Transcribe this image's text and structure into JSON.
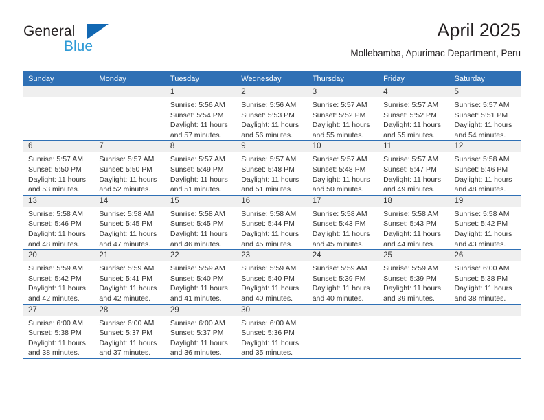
{
  "logo": {
    "primary_text": "General",
    "secondary_text": "Blue",
    "triangle_icon": "blue-triangle-icon",
    "primary_color": "#231f20",
    "secondary_color": "#2e9ad6",
    "triangle_color": "#1268b3"
  },
  "header": {
    "title": "April 2025",
    "subtitle": "Mollebamba, Apurimac Department, Peru"
  },
  "theme": {
    "header_blue": "#2f70b5",
    "daynum_band": "#efefef",
    "text": "#333333"
  },
  "calendar": {
    "weekday_headers": [
      "Sunday",
      "Monday",
      "Tuesday",
      "Wednesday",
      "Thursday",
      "Friday",
      "Saturday"
    ],
    "weeks": [
      [
        {
          "day": "",
          "sunrise": "",
          "sunset": "",
          "daylight": "",
          "empty": true
        },
        {
          "day": "",
          "sunrise": "",
          "sunset": "",
          "daylight": "",
          "empty": true
        },
        {
          "day": "1",
          "sunrise": "Sunrise: 5:56 AM",
          "sunset": "Sunset: 5:54 PM",
          "daylight": "Daylight: 11 hours and 57 minutes."
        },
        {
          "day": "2",
          "sunrise": "Sunrise: 5:56 AM",
          "sunset": "Sunset: 5:53 PM",
          "daylight": "Daylight: 11 hours and 56 minutes."
        },
        {
          "day": "3",
          "sunrise": "Sunrise: 5:57 AM",
          "sunset": "Sunset: 5:52 PM",
          "daylight": "Daylight: 11 hours and 55 minutes."
        },
        {
          "day": "4",
          "sunrise": "Sunrise: 5:57 AM",
          "sunset": "Sunset: 5:52 PM",
          "daylight": "Daylight: 11 hours and 55 minutes."
        },
        {
          "day": "5",
          "sunrise": "Sunrise: 5:57 AM",
          "sunset": "Sunset: 5:51 PM",
          "daylight": "Daylight: 11 hours and 54 minutes."
        }
      ],
      [
        {
          "day": "6",
          "sunrise": "Sunrise: 5:57 AM",
          "sunset": "Sunset: 5:50 PM",
          "daylight": "Daylight: 11 hours and 53 minutes."
        },
        {
          "day": "7",
          "sunrise": "Sunrise: 5:57 AM",
          "sunset": "Sunset: 5:50 PM",
          "daylight": "Daylight: 11 hours and 52 minutes."
        },
        {
          "day": "8",
          "sunrise": "Sunrise: 5:57 AM",
          "sunset": "Sunset: 5:49 PM",
          "daylight": "Daylight: 11 hours and 51 minutes."
        },
        {
          "day": "9",
          "sunrise": "Sunrise: 5:57 AM",
          "sunset": "Sunset: 5:48 PM",
          "daylight": "Daylight: 11 hours and 51 minutes."
        },
        {
          "day": "10",
          "sunrise": "Sunrise: 5:57 AM",
          "sunset": "Sunset: 5:48 PM",
          "daylight": "Daylight: 11 hours and 50 minutes."
        },
        {
          "day": "11",
          "sunrise": "Sunrise: 5:57 AM",
          "sunset": "Sunset: 5:47 PM",
          "daylight": "Daylight: 11 hours and 49 minutes."
        },
        {
          "day": "12",
          "sunrise": "Sunrise: 5:58 AM",
          "sunset": "Sunset: 5:46 PM",
          "daylight": "Daylight: 11 hours and 48 minutes."
        }
      ],
      [
        {
          "day": "13",
          "sunrise": "Sunrise: 5:58 AM",
          "sunset": "Sunset: 5:46 PM",
          "daylight": "Daylight: 11 hours and 48 minutes."
        },
        {
          "day": "14",
          "sunrise": "Sunrise: 5:58 AM",
          "sunset": "Sunset: 5:45 PM",
          "daylight": "Daylight: 11 hours and 47 minutes."
        },
        {
          "day": "15",
          "sunrise": "Sunrise: 5:58 AM",
          "sunset": "Sunset: 5:45 PM",
          "daylight": "Daylight: 11 hours and 46 minutes."
        },
        {
          "day": "16",
          "sunrise": "Sunrise: 5:58 AM",
          "sunset": "Sunset: 5:44 PM",
          "daylight": "Daylight: 11 hours and 45 minutes."
        },
        {
          "day": "17",
          "sunrise": "Sunrise: 5:58 AM",
          "sunset": "Sunset: 5:43 PM",
          "daylight": "Daylight: 11 hours and 45 minutes."
        },
        {
          "day": "18",
          "sunrise": "Sunrise: 5:58 AM",
          "sunset": "Sunset: 5:43 PM",
          "daylight": "Daylight: 11 hours and 44 minutes."
        },
        {
          "day": "19",
          "sunrise": "Sunrise: 5:58 AM",
          "sunset": "Sunset: 5:42 PM",
          "daylight": "Daylight: 11 hours and 43 minutes."
        }
      ],
      [
        {
          "day": "20",
          "sunrise": "Sunrise: 5:59 AM",
          "sunset": "Sunset: 5:42 PM",
          "daylight": "Daylight: 11 hours and 42 minutes."
        },
        {
          "day": "21",
          "sunrise": "Sunrise: 5:59 AM",
          "sunset": "Sunset: 5:41 PM",
          "daylight": "Daylight: 11 hours and 42 minutes."
        },
        {
          "day": "22",
          "sunrise": "Sunrise: 5:59 AM",
          "sunset": "Sunset: 5:40 PM",
          "daylight": "Daylight: 11 hours and 41 minutes."
        },
        {
          "day": "23",
          "sunrise": "Sunrise: 5:59 AM",
          "sunset": "Sunset: 5:40 PM",
          "daylight": "Daylight: 11 hours and 40 minutes."
        },
        {
          "day": "24",
          "sunrise": "Sunrise: 5:59 AM",
          "sunset": "Sunset: 5:39 PM",
          "daylight": "Daylight: 11 hours and 40 minutes."
        },
        {
          "day": "25",
          "sunrise": "Sunrise: 5:59 AM",
          "sunset": "Sunset: 5:39 PM",
          "daylight": "Daylight: 11 hours and 39 minutes."
        },
        {
          "day": "26",
          "sunrise": "Sunrise: 6:00 AM",
          "sunset": "Sunset: 5:38 PM",
          "daylight": "Daylight: 11 hours and 38 minutes."
        }
      ],
      [
        {
          "day": "27",
          "sunrise": "Sunrise: 6:00 AM",
          "sunset": "Sunset: 5:38 PM",
          "daylight": "Daylight: 11 hours and 38 minutes."
        },
        {
          "day": "28",
          "sunrise": "Sunrise: 6:00 AM",
          "sunset": "Sunset: 5:37 PM",
          "daylight": "Daylight: 11 hours and 37 minutes."
        },
        {
          "day": "29",
          "sunrise": "Sunrise: 6:00 AM",
          "sunset": "Sunset: 5:37 PM",
          "daylight": "Daylight: 11 hours and 36 minutes."
        },
        {
          "day": "30",
          "sunrise": "Sunrise: 6:00 AM",
          "sunset": "Sunset: 5:36 PM",
          "daylight": "Daylight: 11 hours and 35 minutes."
        },
        {
          "day": "",
          "sunrise": "",
          "sunset": "",
          "daylight": "",
          "empty": true
        },
        {
          "day": "",
          "sunrise": "",
          "sunset": "",
          "daylight": "",
          "empty": true
        },
        {
          "day": "",
          "sunrise": "",
          "sunset": "",
          "daylight": "",
          "empty": true
        }
      ]
    ]
  }
}
